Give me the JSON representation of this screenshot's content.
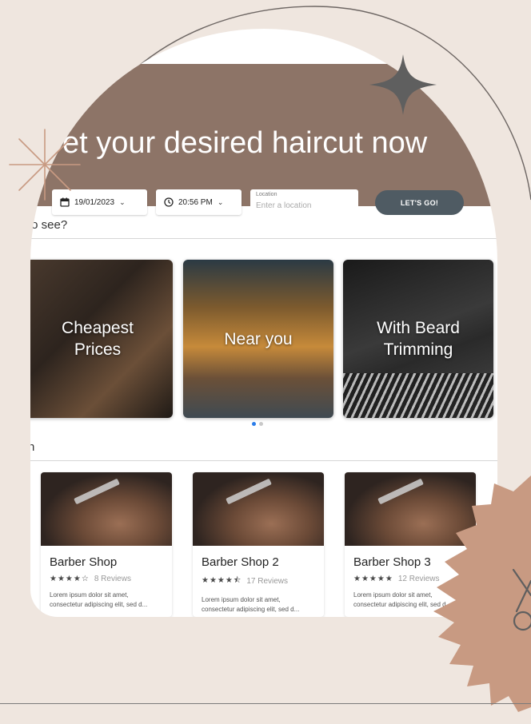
{
  "hero": {
    "title": "et your desired haircut now",
    "date_value": "19/01/2023",
    "time_value": "20:56 PM",
    "location_label": "Location",
    "location_placeholder": "Enter a location",
    "go_label": "LET'S GO!"
  },
  "categories": {
    "heading": "to see?",
    "cards": [
      {
        "label": "Cheapest Prices"
      },
      {
        "label": "Near you"
      },
      {
        "label": "With Beard Trimming"
      }
    ],
    "dots": 2,
    "active_dot": 0
  },
  "shops": {
    "heading": "n",
    "items": [
      {
        "name": "Barber Shop",
        "stars": "★★★★☆",
        "reviews": "8 Reviews",
        "description": "Lorem ipsum dolor sit amet, consectetur adipiscing elit, sed d..."
      },
      {
        "name": "Barber Shop 2",
        "stars": "★★★★⯪",
        "reviews": "17 Reviews",
        "description": "Lorem ipsum dolor sit amet, consectetur adipiscing elit, sed d..."
      },
      {
        "name": "Barber Shop 3",
        "stars": "★★★★★",
        "reviews": "12 Reviews",
        "description": "Lorem ipsum dolor sit amet, consectetur adipiscing elit, sed d..."
      }
    ]
  },
  "colors": {
    "background": "#efe6df",
    "hero": "#8d7467",
    "button": "#4f5b63",
    "accent": "#c89a82",
    "active_dot": "#2b7de9"
  },
  "icons": {
    "date": "calendar-icon",
    "time": "clock-icon",
    "chevron": "chevron-down-icon",
    "scissors": "scissors-icon"
  }
}
